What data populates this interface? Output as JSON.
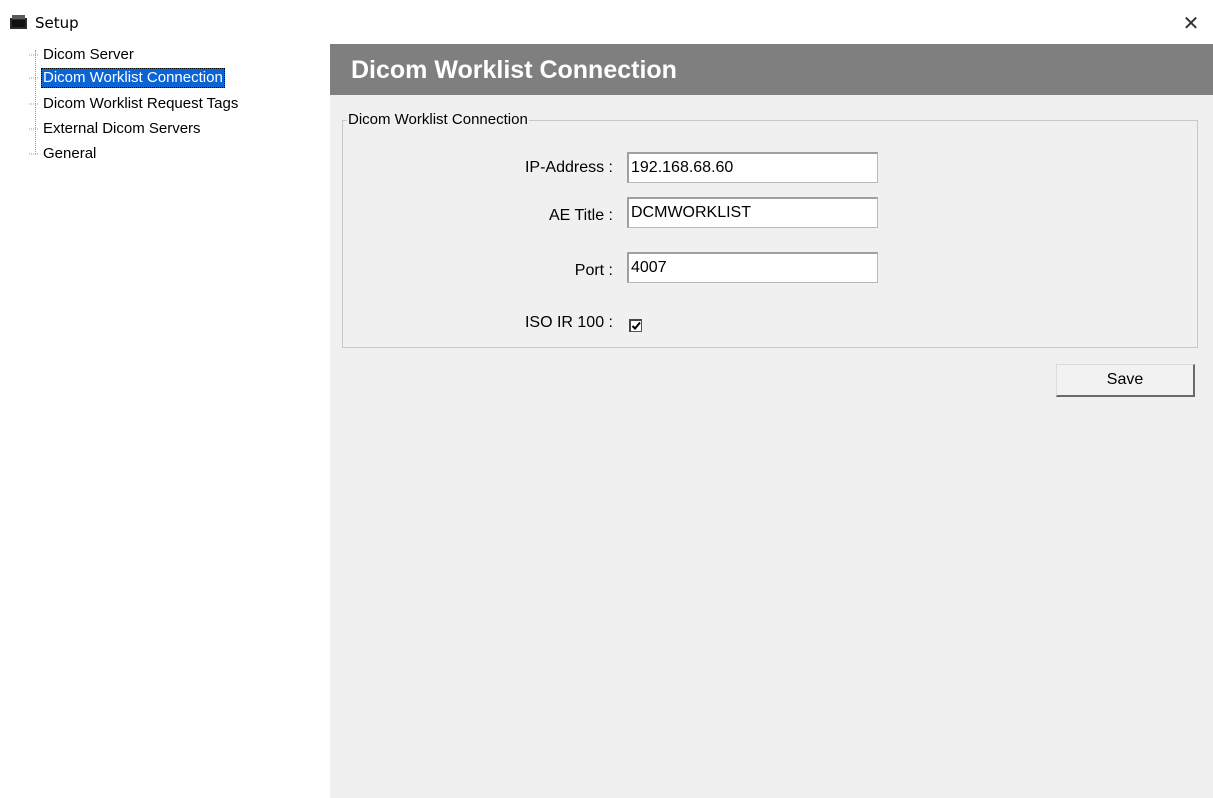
{
  "window": {
    "title": "Setup",
    "close_icon": "close-icon",
    "app_icon": "setup-app-icon"
  },
  "sidebar": {
    "items": [
      {
        "label": "Dicom Server",
        "selected": false
      },
      {
        "label": "Dicom Worklist Connection",
        "selected": true
      },
      {
        "label": "Dicom Worklist Request Tags",
        "selected": false
      },
      {
        "label": "External Dicom Servers",
        "selected": false
      },
      {
        "label": "General",
        "selected": false
      }
    ]
  },
  "main": {
    "header_title": "Dicom Worklist Connection",
    "group_title": "Dicom Worklist Connection",
    "fields": {
      "ip_label": "IP-Address :",
      "ip_value": "192.168.68.60",
      "ae_label": "AE Title :",
      "ae_value": "DCMWORKLIST",
      "port_label": "Port :",
      "port_value": "4007",
      "iso_label": "ISO IR 100 :",
      "iso_checked": true
    },
    "save_label": "Save"
  },
  "colors": {
    "header_bg": "#7f7f7f",
    "selection_bg": "#0a64d6",
    "panel_bg": "#f0f0f0"
  }
}
